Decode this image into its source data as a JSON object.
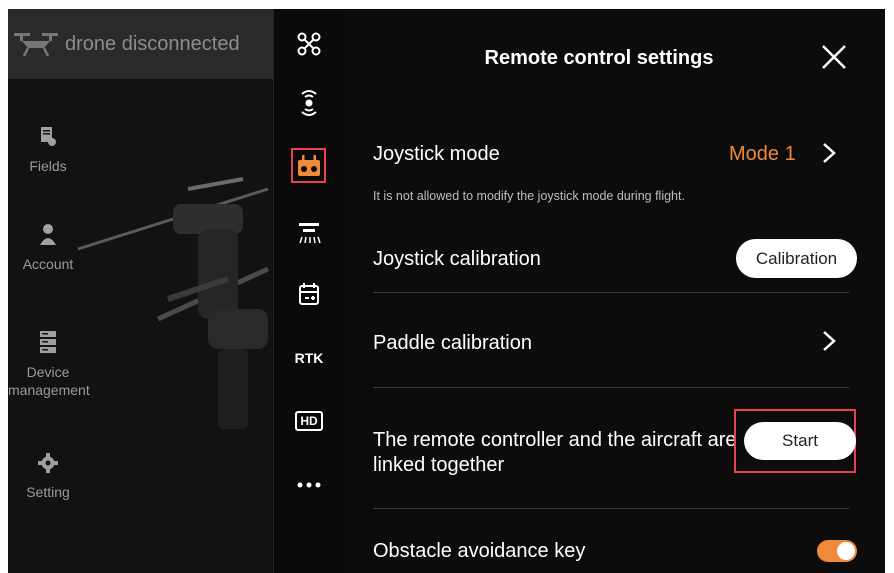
{
  "status": {
    "text": "drone disconnected"
  },
  "left_nav": [
    {
      "label": "Fields",
      "icon": "fields-icon"
    },
    {
      "label": "Account",
      "icon": "account-icon"
    },
    {
      "label": "Device\nmanagement",
      "icon": "device-icon"
    },
    {
      "label": "Setting",
      "icon": "setting-icon"
    }
  ],
  "icon_column": {
    "rtk_label": "RTK",
    "hd_label": "HD",
    "selected": "remote-controller-icon"
  },
  "panel": {
    "title": "Remote control settings",
    "joystick_mode": {
      "label": "Joystick mode",
      "value": "Mode 1",
      "hint": "It is not allowed to modify the joystick mode during flight."
    },
    "joystick_calibration": {
      "label": "Joystick calibration",
      "button": "Calibration"
    },
    "paddle_calibration": {
      "label": "Paddle calibration"
    },
    "link": {
      "label_line1": "The remote controller and the aircraft are",
      "label_line2": "linked together",
      "button": "Start"
    },
    "obstacle_avoidance": {
      "label": "Obstacle avoidance key",
      "enabled": true
    }
  },
  "colors": {
    "accent": "#f0893a",
    "highlight": "#e8414f"
  }
}
